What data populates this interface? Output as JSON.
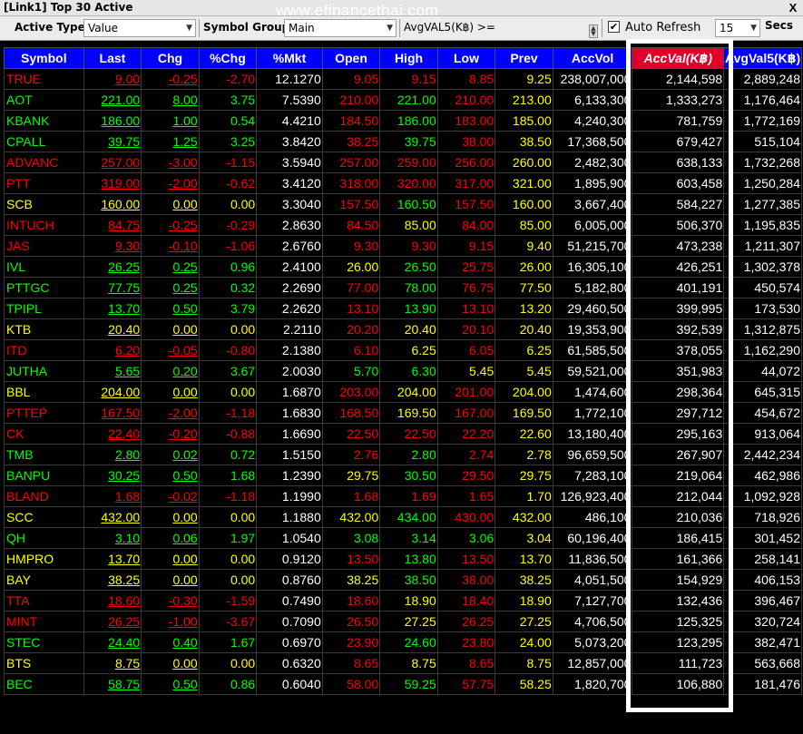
{
  "window": {
    "title": "[Link1] Top 30 Active",
    "close_glyph": "X"
  },
  "watermark": "www.efinancethai.com",
  "toolbar": {
    "active_type_label": "Active Type :",
    "active_type_value": "Value",
    "symbol_group_label": "Symbol Group :",
    "symbol_group_value": "Main",
    "filter_label": "AvgVAL5(K฿) >=",
    "filter_value": "",
    "auto_refresh_label": "Auto Refresh",
    "auto_refresh_checked": true,
    "refresh_interval": "15",
    "secs_label": "Secs"
  },
  "columns": [
    "Symbol",
    "Last",
    "Chg",
    "%Chg",
    "%Mkt",
    "Open",
    "High",
    "Low",
    "Prev",
    "AccVol",
    "AccVal(K฿)",
    "AvgVal5(K฿)"
  ],
  "rows": [
    [
      "TRUE",
      "9.00",
      "-0.25",
      "-2.70",
      "12.1270",
      "9.05",
      "9.15",
      "8.85",
      "9.25",
      "238,007,000",
      "2,144,598",
      "2,889,248"
    ],
    [
      "AOT",
      "221.00",
      "8.00",
      "3.75",
      "7.5390",
      "210.00",
      "221.00",
      "210.00",
      "213.00",
      "6,133,300",
      "1,333,273",
      "1,176,464"
    ],
    [
      "KBANK",
      "186.00",
      "1.00",
      "0.54",
      "4.4210",
      "184.50",
      "186.00",
      "183.00",
      "185.00",
      "4,240,300",
      "781,759",
      "1,772,169"
    ],
    [
      "CPALL",
      "39.75",
      "1.25",
      "3.25",
      "3.8420",
      "38.25",
      "39.75",
      "38.00",
      "38.50",
      "17,368,500",
      "679,427",
      "515,104"
    ],
    [
      "ADVANC",
      "257.00",
      "-3.00",
      "-1.15",
      "3.5940",
      "257.00",
      "259.00",
      "256.00",
      "260.00",
      "2,482,300",
      "638,133",
      "1,732,268"
    ],
    [
      "PTT",
      "319.00",
      "-2.00",
      "-0.62",
      "3.4120",
      "318.00",
      "320.00",
      "317.00",
      "321.00",
      "1,895,900",
      "603,458",
      "1,250,284"
    ],
    [
      "SCB",
      "160.00",
      "0.00",
      "0.00",
      "3.3040",
      "157.50",
      "160.50",
      "157.50",
      "160.00",
      "3,667,400",
      "584,227",
      "1,277,385"
    ],
    [
      "INTUCH",
      "84.75",
      "-0.25",
      "-0.29",
      "2.8630",
      "84.50",
      "85.00",
      "84.00",
      "85.00",
      "6,005,000",
      "506,370",
      "1,195,835"
    ],
    [
      "JAS",
      "9.30",
      "-0.10",
      "-1.06",
      "2.6760",
      "9.30",
      "9.30",
      "9.15",
      "9.40",
      "51,215,700",
      "473,238",
      "1,211,307"
    ],
    [
      "IVL",
      "26.25",
      "0.25",
      "0.96",
      "2.4100",
      "26.00",
      "26.50",
      "25.75",
      "26.00",
      "16,305,100",
      "426,251",
      "1,302,378"
    ],
    [
      "PTTGC",
      "77.75",
      "0.25",
      "0.32",
      "2.2690",
      "77.00",
      "78.00",
      "76.75",
      "77.50",
      "5,182,800",
      "401,191",
      "450,574"
    ],
    [
      "TPIPL",
      "13.70",
      "0.50",
      "3.79",
      "2.2620",
      "13.10",
      "13.90",
      "13.10",
      "13.20",
      "29,460,500",
      "399,995",
      "173,530"
    ],
    [
      "KTB",
      "20.40",
      "0.00",
      "0.00",
      "2.2110",
      "20.20",
      "20.40",
      "20.10",
      "20.40",
      "19,353,900",
      "392,539",
      "1,312,875"
    ],
    [
      "ITD",
      "6.20",
      "-0.05",
      "-0.80",
      "2.1380",
      "6.10",
      "6.25",
      "6.05",
      "6.25",
      "61,585,500",
      "378,055",
      "1,162,290"
    ],
    [
      "JUTHA",
      "5.65",
      "0.20",
      "3.67",
      "2.0030",
      "5.70",
      "6.30",
      "5.45",
      "5.45",
      "59,521,000",
      "351,983",
      "44,072"
    ],
    [
      "BBL",
      "204.00",
      "0.00",
      "0.00",
      "1.6870",
      "203.00",
      "204.00",
      "201.00",
      "204.00",
      "1,474,600",
      "298,364",
      "645,315"
    ],
    [
      "PTTEP",
      "167.50",
      "-2.00",
      "-1.18",
      "1.6830",
      "168.50",
      "169.50",
      "167.00",
      "169.50",
      "1,772,100",
      "297,712",
      "454,672"
    ],
    [
      "CK",
      "22.40",
      "-0.20",
      "-0.88",
      "1.6690",
      "22.50",
      "22.50",
      "22.20",
      "22.60",
      "13,180,400",
      "295,163",
      "913,064"
    ],
    [
      "TMB",
      "2.80",
      "0.02",
      "0.72",
      "1.5150",
      "2.76",
      "2.80",
      "2.74",
      "2.78",
      "96,659,500",
      "267,907",
      "2,442,234"
    ],
    [
      "BANPU",
      "30.25",
      "0.50",
      "1.68",
      "1.2390",
      "29.75",
      "30.50",
      "29.50",
      "29.75",
      "7,283,100",
      "219,064",
      "462,986"
    ],
    [
      "BLAND",
      "1.68",
      "-0.02",
      "-1.18",
      "1.1990",
      "1.68",
      "1.69",
      "1.65",
      "1.70",
      "126,923,400",
      "212,044",
      "1,092,928"
    ],
    [
      "SCC",
      "432.00",
      "0.00",
      "0.00",
      "1.1880",
      "432.00",
      "434.00",
      "430.00",
      "432.00",
      "486,100",
      "210,036",
      "718,926"
    ],
    [
      "QH",
      "3.10",
      "0.06",
      "1.97",
      "1.0540",
      "3.08",
      "3.14",
      "3.06",
      "3.04",
      "60,196,400",
      "186,415",
      "301,452"
    ],
    [
      "HMPRO",
      "13.70",
      "0.00",
      "0.00",
      "0.9120",
      "13.50",
      "13.80",
      "13.50",
      "13.70",
      "11,836,500",
      "161,366",
      "258,141"
    ],
    [
      "BAY",
      "38.25",
      "0.00",
      "0.00",
      "0.8760",
      "38.25",
      "38.50",
      "38.00",
      "38.25",
      "4,051,500",
      "154,929",
      "406,153"
    ],
    [
      "TTA",
      "18.60",
      "-0.30",
      "-1.59",
      "0.7490",
      "18.60",
      "18.90",
      "18.40",
      "18.90",
      "7,127,700",
      "132,436",
      "396,467"
    ],
    [
      "MINT",
      "26.25",
      "-1.00",
      "-3.67",
      "0.7090",
      "26.50",
      "27.25",
      "26.25",
      "27.25",
      "4,706,500",
      "125,325",
      "320,724"
    ],
    [
      "STEC",
      "24.40",
      "0.40",
      "1.67",
      "0.6970",
      "23.90",
      "24.60",
      "23.80",
      "24.00",
      "5,073,200",
      "123,295",
      "382,471"
    ],
    [
      "BTS",
      "8.75",
      "0.00",
      "0.00",
      "0.6320",
      "8.65",
      "8.75",
      "8.65",
      "8.75",
      "12,857,000",
      "111,723",
      "563,668"
    ],
    [
      "BEC",
      "58.75",
      "0.50",
      "0.86",
      "0.6040",
      "58.00",
      "59.25",
      "57.75",
      "58.25",
      "1,820,700",
      "106,880",
      "181,476"
    ]
  ],
  "colors": {
    "header_bg": "#0000ff",
    "sort_header_bg": "#e0002a",
    "up": "#00ff00",
    "down": "#ff0000",
    "unchanged": "#ffff00",
    "neutral": "#ffffff"
  }
}
